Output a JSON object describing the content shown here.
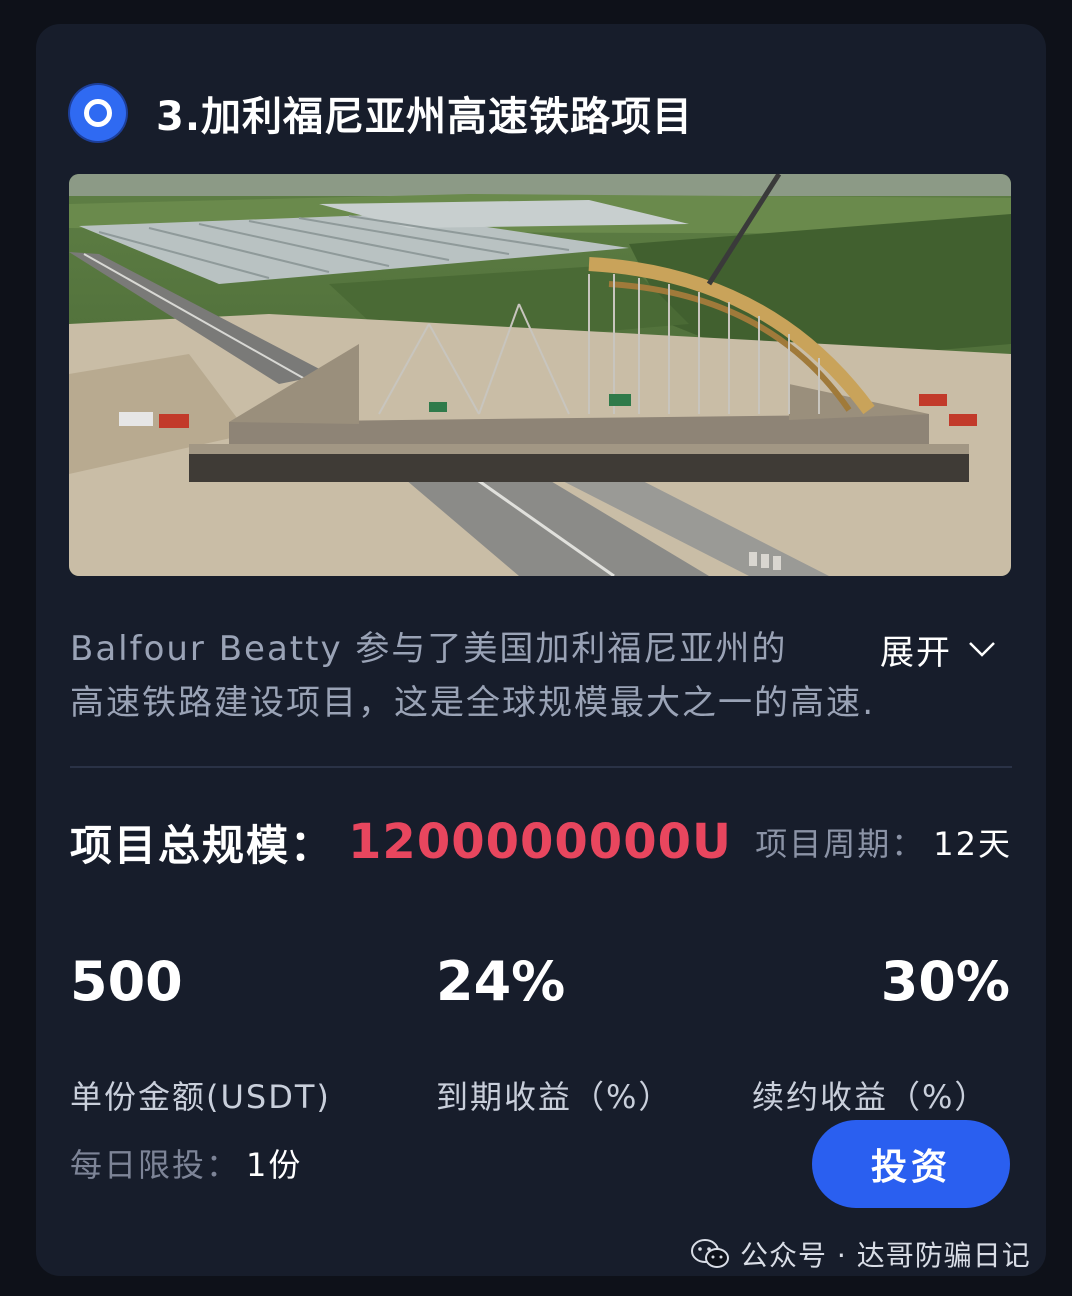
{
  "project": {
    "title": "3.加利福尼亚州高速铁路项目",
    "description_line1": "Balfour Beatty 参与了美国加利福尼亚州的",
    "description_line2": "高速铁路建设项目，这是全球规模最大之一的高速…",
    "expand_label": "展开"
  },
  "scale": {
    "label": "项目总规模：",
    "value": "1200000000U"
  },
  "period": {
    "label": "项目周期：",
    "value": "12天"
  },
  "stats": [
    {
      "value": "500",
      "caption": "单份金额(USDT)"
    },
    {
      "value": "24%",
      "caption": "到期收益（%）"
    },
    {
      "value": "30%",
      "caption": "续约收益（%）"
    }
  ],
  "limit": {
    "label": "每日限投：",
    "value": "1份"
  },
  "invest_button": "投资",
  "watermark": "公众号 · 达哥防骗日记",
  "colors": {
    "background": "#0e1119",
    "card": "#171d2b",
    "accent_blue": "#2a5ff0",
    "scale_red": "#e8465e"
  },
  "icons": {
    "header": "ring-icon",
    "expand": "chevron-down-icon",
    "watermark": "wechat-icon"
  }
}
